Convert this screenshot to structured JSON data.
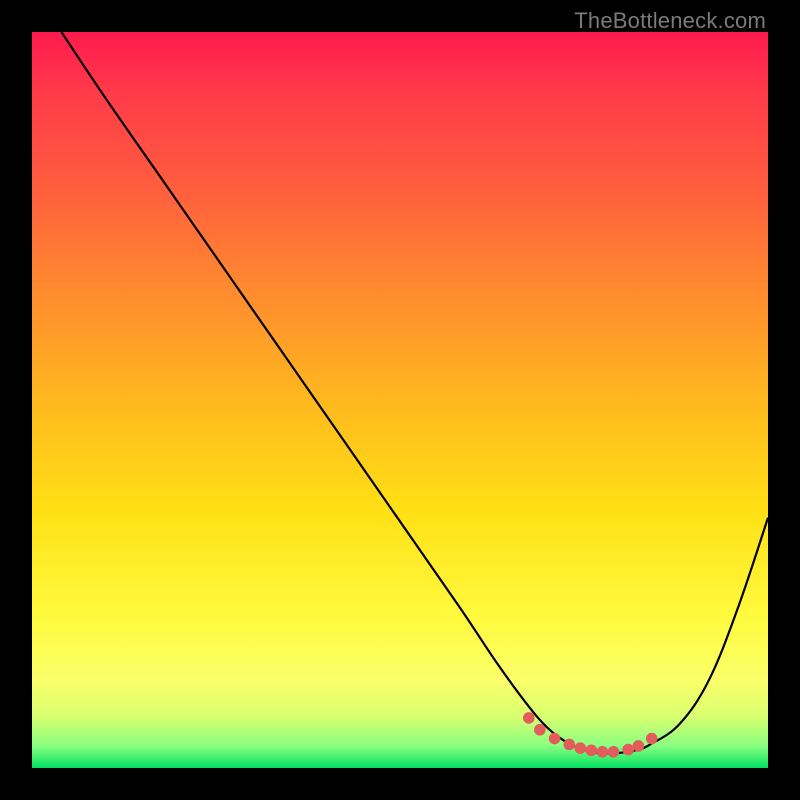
{
  "watermark": "TheBottleneck.com",
  "chart_data": {
    "type": "line",
    "title": "",
    "xlabel": "",
    "ylabel": "",
    "xlim": [
      0,
      100
    ],
    "ylim": [
      0,
      100
    ],
    "series": [
      {
        "name": "curve",
        "x": [
          4,
          10,
          18,
          26,
          34,
          42,
          50,
          58,
          63,
          67,
          70,
          73,
          76,
          79,
          82,
          84,
          88,
          92,
          96,
          100
        ],
        "y": [
          100,
          91,
          79.5,
          68,
          56.5,
          45,
          33.5,
          22,
          14.5,
          9,
          5.5,
          3.3,
          2.2,
          2,
          2.4,
          3.2,
          6,
          12,
          22,
          34
        ],
        "color": "#000000"
      },
      {
        "name": "highlight-dots",
        "x": [
          67.5,
          69,
          71,
          73,
          74.5,
          76,
          77.5,
          79,
          81,
          82.4,
          84.2
        ],
        "y": [
          6.8,
          5.2,
          4.0,
          3.2,
          2.7,
          2.4,
          2.2,
          2.2,
          2.5,
          3.0,
          4.0
        ],
        "color": "#e35b5b"
      }
    ]
  }
}
